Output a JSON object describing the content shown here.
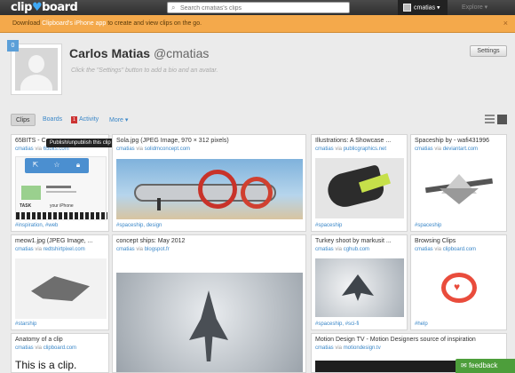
{
  "app": {
    "logo_text": "clip",
    "logo_heart": "♥",
    "logo_tail": "board"
  },
  "search": {
    "placeholder": "Search cmatias's clips"
  },
  "user_menu": {
    "label": "cmatias ▾"
  },
  "nav": {
    "explore": "Explore ▾"
  },
  "banner": {
    "prefix": "Download ",
    "link": "Clipboard's iPhone app",
    "suffix": " to create and view clips on the go."
  },
  "profile": {
    "clip_count": "0",
    "name": "Carlos Matias",
    "handle": "@cmatias",
    "bio_placeholder": "Click the \"Settings\" button to add a bio and an avatar.",
    "settings_label": "Settings"
  },
  "tabs": {
    "clips": "Clips",
    "boards": "Boards",
    "activity_count": "1",
    "activity": "Activity",
    "more": "More ▾"
  },
  "tooltip": "Publish/unpublish this clip",
  "cards": [
    {
      "title": "65BITS - C",
      "by": "cmatias",
      "via_word": " via ",
      "source": "65bits.com",
      "tag": "#inspiration, #web"
    },
    {
      "title": "Sola.jpg (JPEG Image, 970 × 312 pixels)",
      "by": "cmatias",
      "via_word": " via ",
      "source": "solidmconcept.com",
      "tag": "#spaceship, design"
    },
    {
      "title": "Illustrations: A Showcase ...",
      "by": "cmatias",
      "via_word": " via ",
      "source": "publicgraphics.net",
      "tag": "#spaceship"
    },
    {
      "title": "Spaceship by - wafi431996",
      "by": "cmatias",
      "via_word": " via ",
      "source": "deviantart.com",
      "tag": "#spaceship"
    },
    {
      "title": "meow1.jpg (JPEG Image, ...",
      "by": "cmatias",
      "via_word": " via ",
      "source": "redtshirtpixel.com",
      "tag": "#starship"
    },
    {
      "title": "concept ships: May 2012",
      "by": "cmatias",
      "via_word": " via ",
      "source": "blogspot.fr",
      "tag": ""
    },
    {
      "title": "Turkey shoot by markusit ...",
      "by": "cmatias",
      "via_word": " via ",
      "source": "cghub.com",
      "tag": "#spaceship, #sci-fi"
    },
    {
      "title": "Browsing Clips",
      "by": "cmatias",
      "via_word": " via ",
      "source": "clipboard.com",
      "tag": "#help"
    },
    {
      "title": "Anatomy of a clip",
      "by": "cmatias",
      "via_word": " via ",
      "source": "clipboard.com",
      "big_text": "This is a clip.",
      "tag": ""
    },
    {
      "title": "Motion Design TV - Motion Designers source of inspiration",
      "by": "cmatias",
      "via_word": " via ",
      "source": "motiondesign.tv",
      "tag": ""
    }
  ],
  "mini_site": {
    "line1": "TASK",
    "line2": "your iPhone"
  },
  "feedback": "feedback",
  "colors": {
    "accent": "#3a87c8",
    "banner": "#f4a94b",
    "topbar": "#2f2f2f",
    "feedback": "#4d9e3b",
    "hover_bar": "#4b8fd0"
  }
}
